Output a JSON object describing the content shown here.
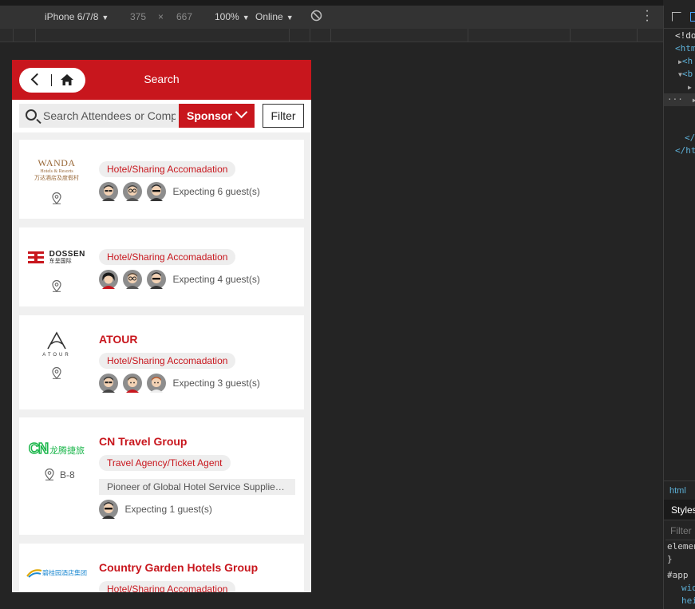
{
  "devtools": {
    "device": "iPhone 6/7/8",
    "width": "375",
    "times": "×",
    "height": "667",
    "zoom": "100%",
    "network": "Online",
    "code_lines": [
      "<!do",
      "<htm",
      "<h",
      "<b",
      "",
      "",
      "",
      "",
      "</",
      "</ht"
    ],
    "breadcrumb": "html",
    "styles_tab": "Styles",
    "filter_placeholder": "Filter",
    "rule1": "elemen",
    "rule1_close": "}",
    "rule2": "#app",
    "rule2_p1": "wid",
    "rule2_p2": "hei"
  },
  "header": {
    "title": "Search"
  },
  "search": {
    "placeholder": "Search Attendees or Company",
    "category": "Sponsor",
    "filter_label": "Filter"
  },
  "cards": [
    {
      "logo_text": "WANDA",
      "logo_sub": "Hotels & Resorts",
      "logo_cn": "万达酒店及度假村",
      "name": "",
      "tag": "Hotel/Sharing Accomadation",
      "booth": "",
      "desc": "",
      "guests": "Expecting 6 guest(s)"
    },
    {
      "logo_text": "DOSSEN",
      "logo_cn": "东呈国际",
      "name": "",
      "tag": "Hotel/Sharing Accomadation",
      "booth": "",
      "desc": "",
      "guests": "Expecting 4 guest(s)"
    },
    {
      "logo_text": "ATOUR",
      "name": "ATOUR",
      "tag": "Hotel/Sharing Accomadation",
      "booth": "",
      "desc": "",
      "guests": "Expecting 3 guest(s)"
    },
    {
      "logo_text": "CN",
      "logo_cn": "龙腾捷旅",
      "name": "CN Travel Group",
      "tag": "Travel Agency/Ticket Agent",
      "booth": "B-8",
      "desc": "Pioneer of Global Hotel Service Supplier in China",
      "guests": "Expecting 1 guest(s)"
    },
    {
      "logo_cn": "碧桂园酒店集团",
      "name": "Country Garden Hotels Group",
      "tag": "Hotel/Sharing Accomadation",
      "booth": "",
      "desc": "",
      "guests": ""
    }
  ],
  "colors": {
    "brand": "#c8161d",
    "cn_green": "#1bb64b"
  }
}
